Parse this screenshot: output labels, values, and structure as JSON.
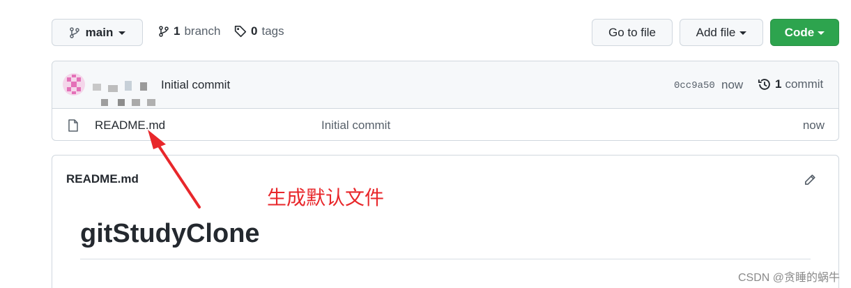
{
  "toolbar": {
    "branch_select": "main",
    "branches_count": "1",
    "branches_label": "branch",
    "tags_count": "0",
    "tags_label": "tags",
    "go_to_file": "Go to file",
    "add_file": "Add file",
    "code": "Code"
  },
  "commit": {
    "message": "Initial commit",
    "hash": "0cc9a50",
    "time": "now",
    "count": "1",
    "count_label": "commit"
  },
  "files": [
    {
      "name": "README.md",
      "message": "Initial commit",
      "time": "now"
    }
  ],
  "readme": {
    "header": "README.md",
    "title": "gitStudyClone"
  },
  "annotation": {
    "text": "生成默认文件",
    "color": "#e8272b"
  },
  "watermark": "CSDN @贪睡的蜗牛",
  "colors": {
    "code_button": "#2da44e",
    "border": "#d0d7de"
  }
}
